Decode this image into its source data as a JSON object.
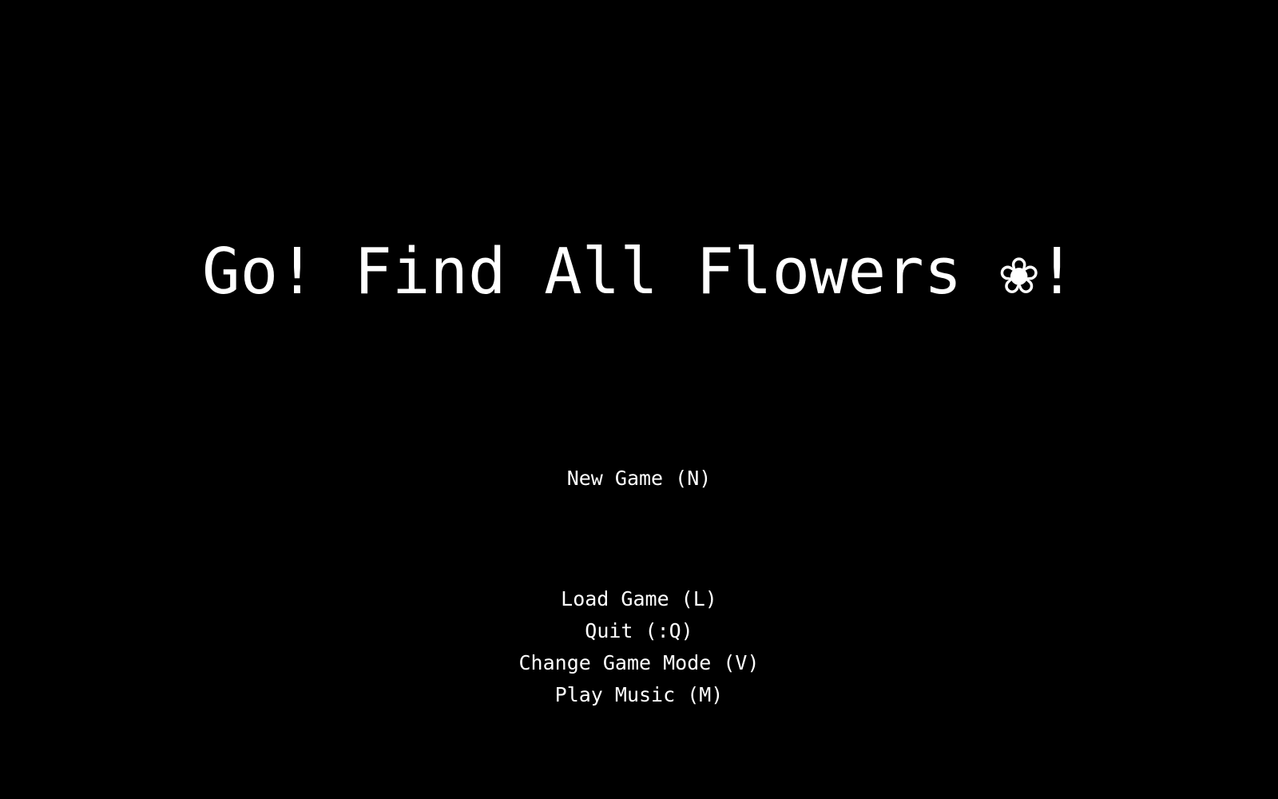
{
  "title": "Go! Find All Flowers ❀!",
  "menu": {
    "new_game": "New Game (N)",
    "load_game": "Load Game (L)",
    "quit": "Quit (:Q)",
    "change_mode": "Change Game Mode (V)",
    "play_music": "Play Music (M)"
  },
  "colors": {
    "background": "#000000",
    "text": "#ffffff"
  }
}
